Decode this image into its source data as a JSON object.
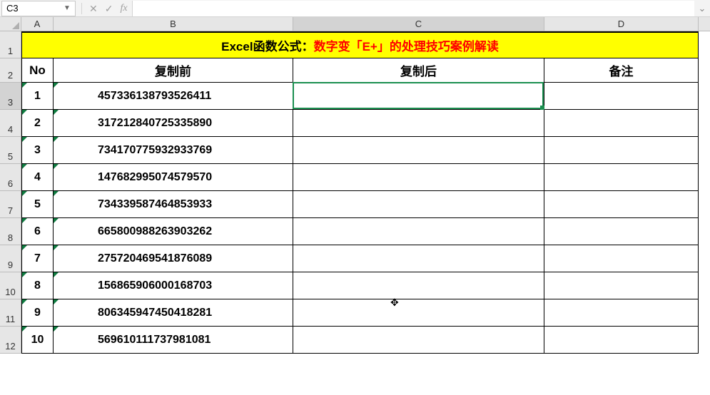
{
  "name_box": {
    "value": "C3"
  },
  "formula_bar": {
    "value": ""
  },
  "columns": {
    "labels": [
      "A",
      "B",
      "C",
      "D"
    ],
    "widths": [
      45,
      336,
      352,
      216
    ],
    "active_index": 2
  },
  "row_header_width": 30,
  "active_cell": {
    "col": 2,
    "row_index": 2
  },
  "title": {
    "black_prefix": "Excel函数公式：",
    "red_part": "数字变「E+」的处理技巧案例解读"
  },
  "headers": {
    "no": "No",
    "before": "复制前",
    "after": "复制后",
    "remark": "备注"
  },
  "rows": [
    {
      "no": "1",
      "before": "457336138793526411",
      "after": "",
      "remark": ""
    },
    {
      "no": "2",
      "before": "317212840725335890",
      "after": "",
      "remark": ""
    },
    {
      "no": "3",
      "before": "734170775932933769",
      "after": "",
      "remark": ""
    },
    {
      "no": "4",
      "before": "147682995074579570",
      "after": "",
      "remark": ""
    },
    {
      "no": "5",
      "before": "734339587464853933",
      "after": "",
      "remark": ""
    },
    {
      "no": "6",
      "before": "665800988263903262",
      "after": "",
      "remark": ""
    },
    {
      "no": "7",
      "before": "275720469541876089",
      "after": "",
      "remark": ""
    },
    {
      "no": "8",
      "before": "156865906000168703",
      "after": "",
      "remark": ""
    },
    {
      "no": "9",
      "before": "806345947450418281",
      "after": "",
      "remark": ""
    },
    {
      "no": "10",
      "before": "569610111737981081",
      "after": "",
      "remark": ""
    }
  ],
  "row_heights": {
    "title": 38,
    "header": 34,
    "data": 38
  }
}
